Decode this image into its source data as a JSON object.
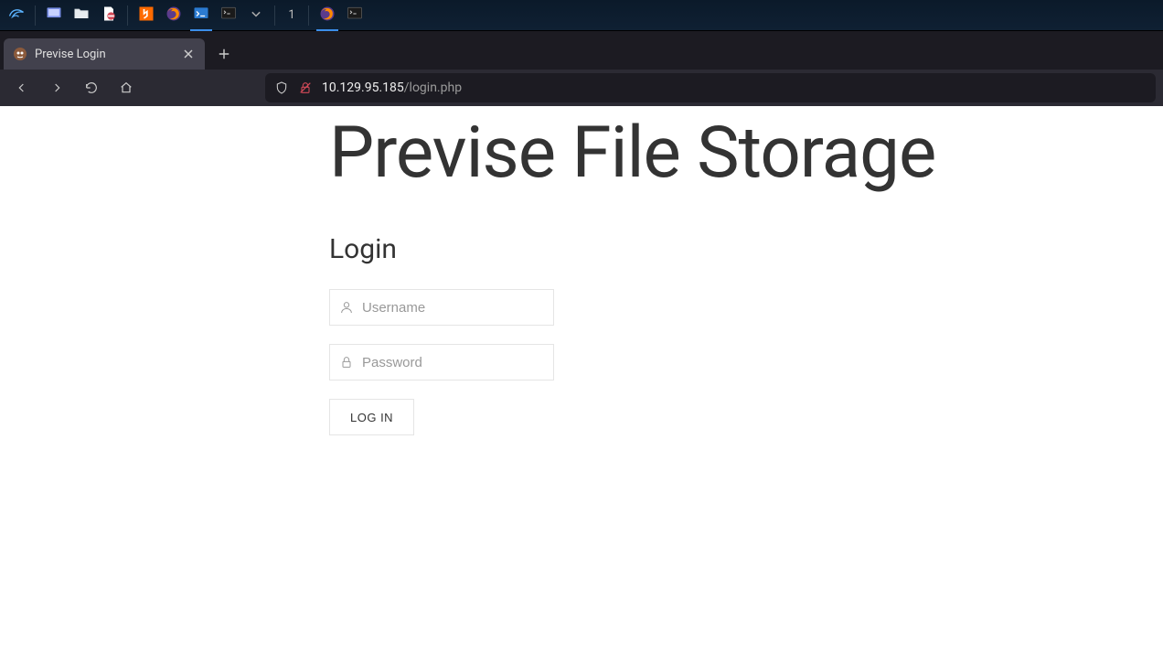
{
  "taskbar": {
    "workspace": "1"
  },
  "browser": {
    "tab_title": "Previse Login",
    "url_domain": "10.129.95.185",
    "url_path": "/login.php"
  },
  "page": {
    "heading": "Previse File Storage",
    "subheading": "Login",
    "username_placeholder": "Username",
    "password_placeholder": "Password",
    "login_button": "LOG IN"
  }
}
